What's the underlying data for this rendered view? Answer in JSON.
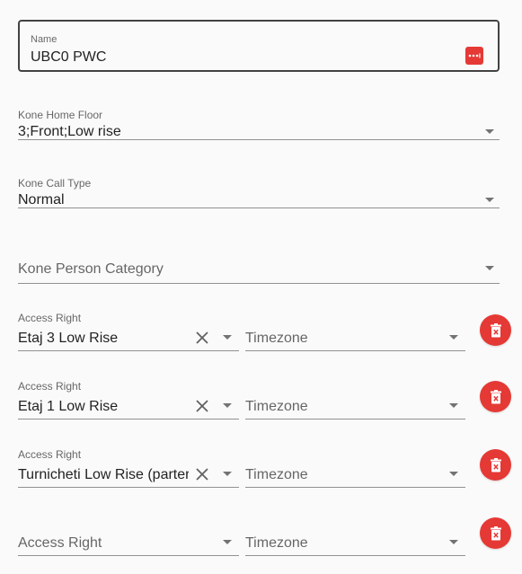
{
  "name_field": {
    "label": "Name",
    "value": "UBC0 PWC",
    "icon": "password-dots-icon"
  },
  "kone_home_floor": {
    "label": "Kone Home Floor",
    "value": "3;Front;Low rise"
  },
  "kone_call_type": {
    "label": "Kone Call Type",
    "value": "Normal"
  },
  "kone_person_category": {
    "placeholder": "Kone Person Category"
  },
  "access_rights": [
    {
      "label": "Access Right",
      "value": "Etaj 3 Low Rise",
      "timezone_placeholder": "Timezone"
    },
    {
      "label": "Access Right",
      "value": "Etaj 1 Low Rise",
      "timezone_placeholder": "Timezone"
    },
    {
      "label": "Access Right",
      "value": "Turnicheti Low Rise (parter",
      "timezone_placeholder": "Timezone"
    },
    {
      "placeholder": "Access Right",
      "timezone_placeholder": "Timezone"
    }
  ],
  "colors": {
    "accent_red": "#e53935",
    "outline": "#424242",
    "background": "#fafafa"
  },
  "icons": {
    "clear": "close-icon",
    "dropdown": "chevron-down-icon",
    "delete": "delete-icon"
  }
}
